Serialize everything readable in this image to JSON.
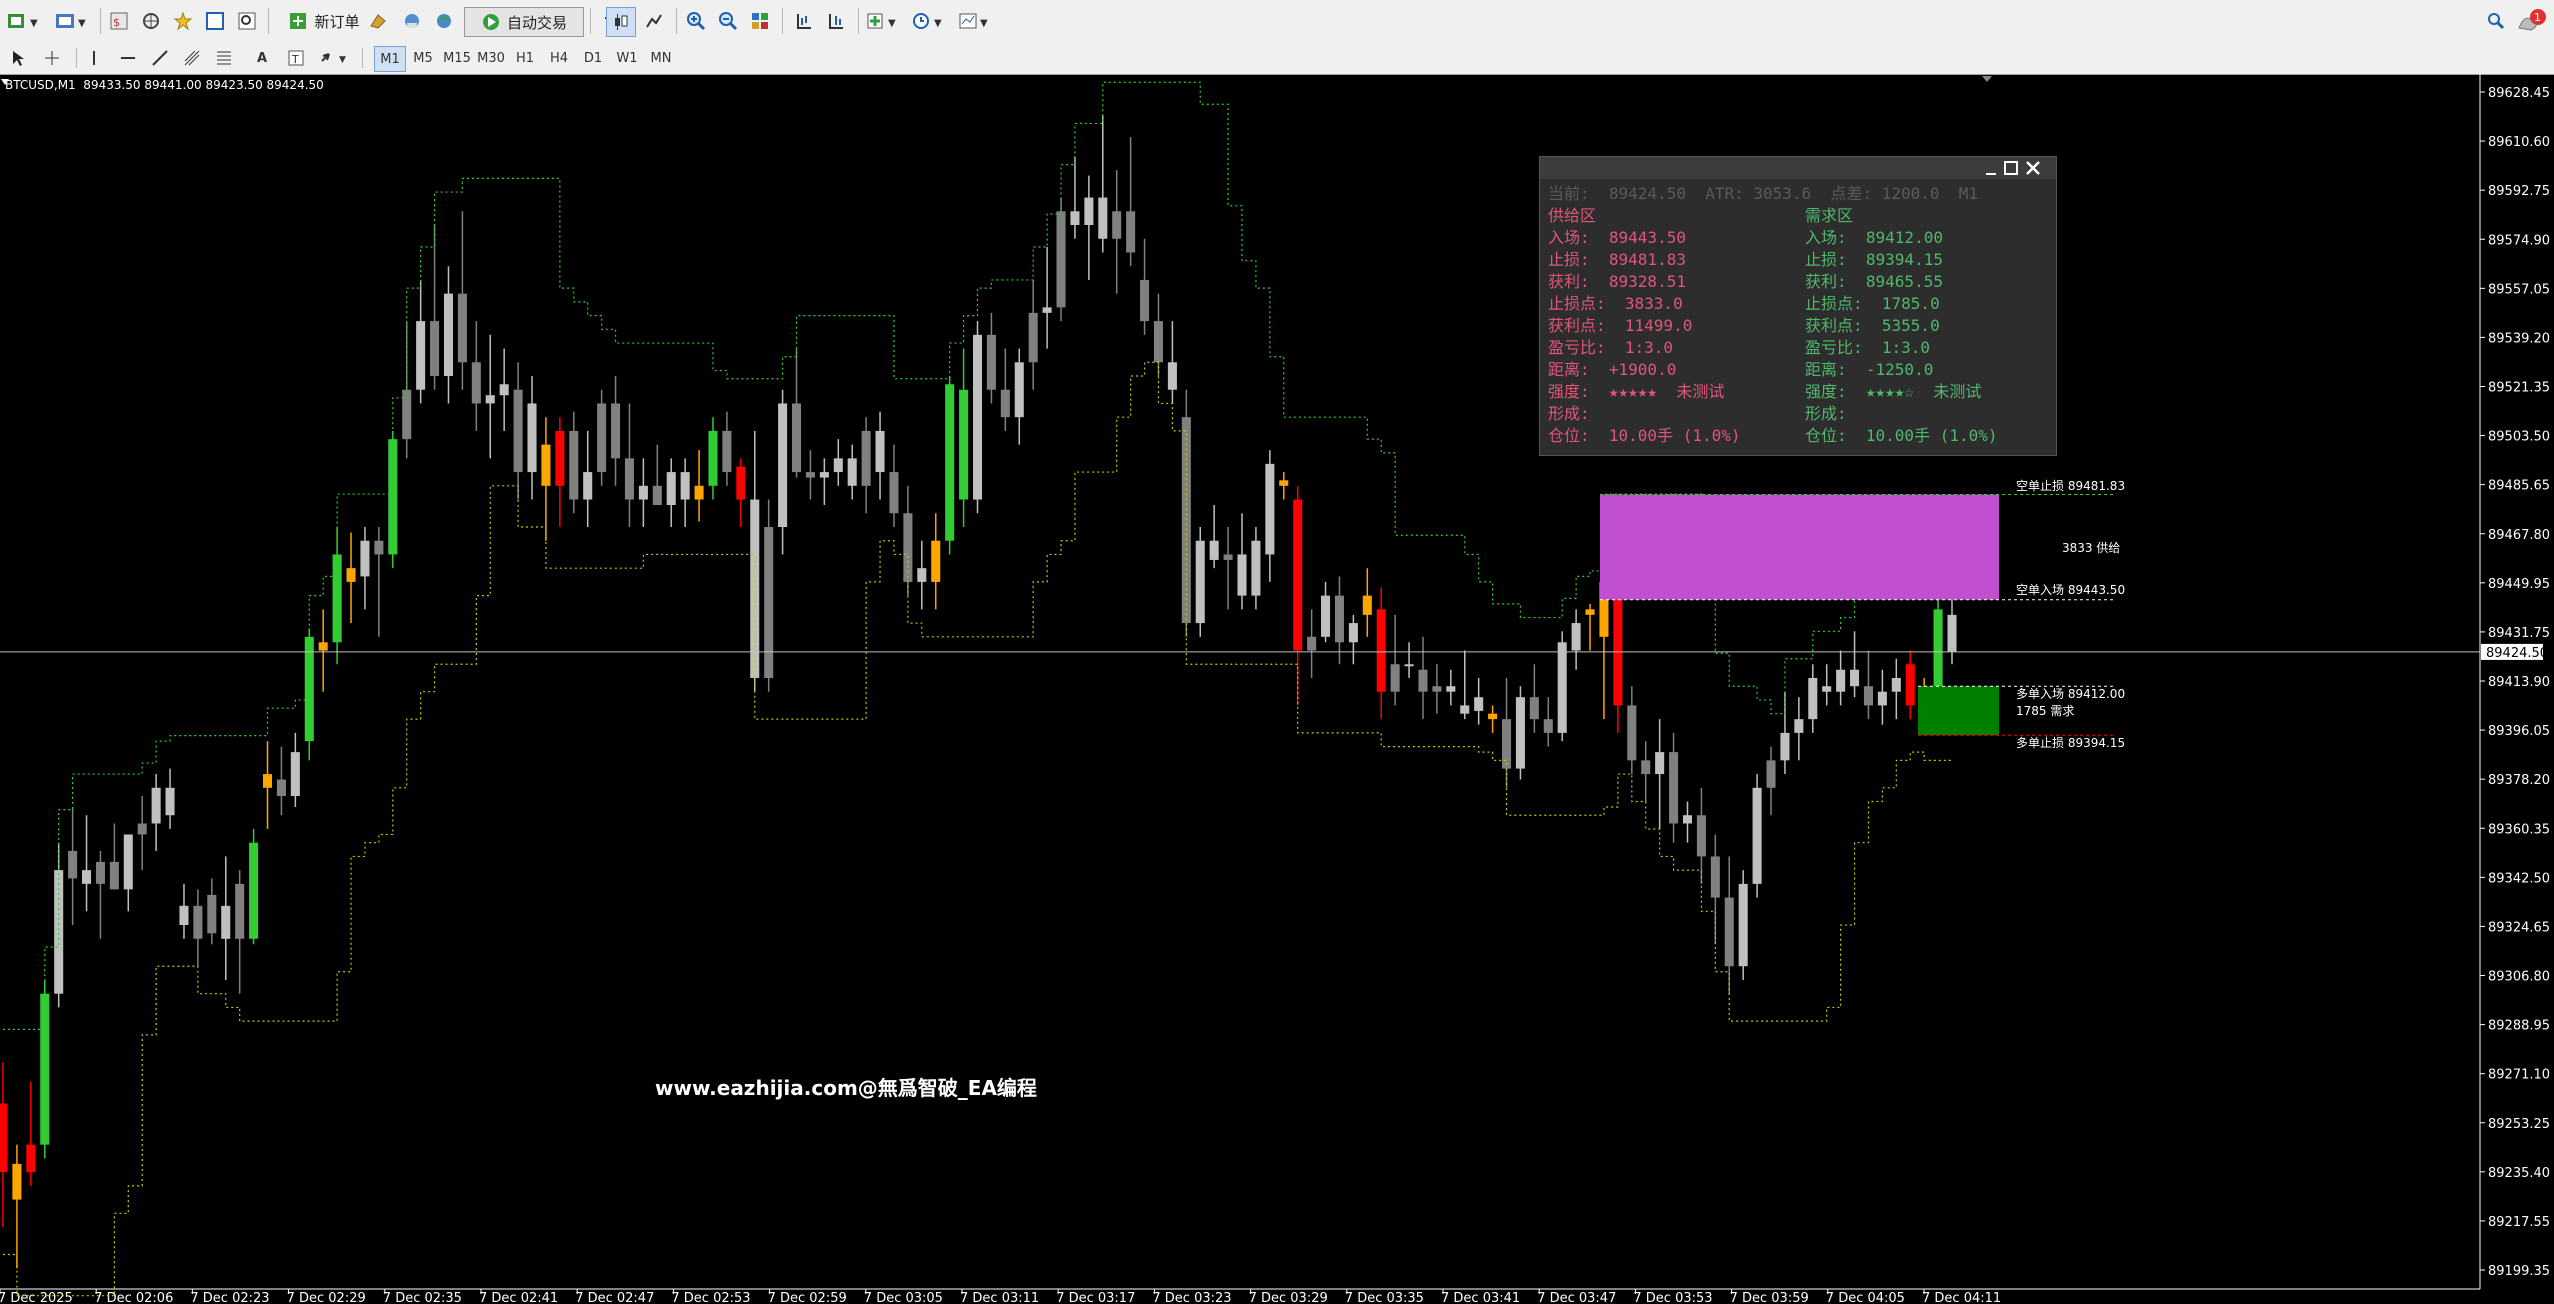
{
  "toolbar": {
    "new_order_label": "新订单",
    "auto_trade_label": "自动交易",
    "notification_count": "1"
  },
  "timeframes": [
    "M1",
    "M5",
    "M15",
    "M30",
    "H1",
    "H4",
    "D1",
    "W1",
    "MN"
  ],
  "symbol_line": "BTCUSD,M1  89433.50 89441.00 89423.50 89424.50",
  "price_axis": {
    "labels": [
      "89628.45",
      "89610.60",
      "89592.75",
      "89574.90",
      "89557.05",
      "89539.20",
      "89521.35",
      "89503.50",
      "89485.65",
      "89467.80",
      "89449.95",
      "89431.75",
      "89413.90",
      "89396.05",
      "89378.20",
      "89360.35",
      "89342.50",
      "89324.65",
      "89306.80",
      "89288.95",
      "89271.10",
      "89253.25",
      "89235.40",
      "89217.55",
      "89199.35"
    ],
    "current_price": "89424.50"
  },
  "time_axis": {
    "labels": [
      "7 Dec 2025",
      "7 Dec 02:06",
      "7 Dec 02:23",
      "7 Dec 02:29",
      "7 Dec 02:35",
      "7 Dec 02:41",
      "7 Dec 02:47",
      "7 Dec 02:53",
      "7 Dec 02:59",
      "7 Dec 03:05",
      "7 Dec 03:11",
      "7 Dec 03:17",
      "7 Dec 03:23",
      "7 Dec 03:29",
      "7 Dec 03:35",
      "7 Dec 03:41",
      "7 Dec 03:47",
      "7 Dec 03:53",
      "7 Dec 03:59",
      "7 Dec 04:05",
      "7 Dec 04:11"
    ]
  },
  "panel": {
    "header": "当前:  89424.50  ATR: 3053.6  点差: 1200.0  M1",
    "supply": {
      "title": "供给区",
      "entry": "入场:  89443.50",
      "sl": "止损:  89481.83",
      "tp": "获利:  89328.51",
      "sl_pts": "止损点:  3833.0",
      "tp_pts": "获利点:  11499.0",
      "rr": "盈亏比:  1:3.0",
      "dist": "距离:  +1900.0",
      "strength": "强度:  ★★★★★  未测试",
      "formed": "形成:",
      "position": "仓位:  10.00手 (1.0%)"
    },
    "demand": {
      "title": "需求区",
      "entry": "入场:  89412.00",
      "sl": "止损:  89394.15",
      "tp": "获利:  89465.55",
      "sl_pts": "止损点:  1785.0",
      "tp_pts": "获利点:  5355.0",
      "rr": "盈亏比:  1:3.0",
      "dist": "距离:  -1250.0",
      "strength": "强度:  ★★★★☆  未测试",
      "formed": "形成:",
      "position": "仓位:  10.00手 (1.0%)"
    }
  },
  "annotations": {
    "short_sl": "空单止损 89481.83",
    "supply_label": "3833 供给",
    "short_entry": "空单入场 89443.50",
    "long_entry": "多单入场 89412.00",
    "demand_label": "1785 需求",
    "long_sl": "多单止损 89394.15"
  },
  "watermark": "www.eazhijia.com@無爲智破_EA编程",
  "colors": {
    "supply_zone": "#c050d0",
    "demand_zone": "#008000",
    "bull": "#32cd32",
    "bear": "#ff0000",
    "neutral_bull": "#c0c0c0",
    "neutral_bear": "#808080",
    "orange": "#ffa500",
    "trail_green": "#32cd32",
    "trail_yellow": "#c8c800"
  },
  "chart_data": {
    "type": "candlestick",
    "symbol": "BTCUSD",
    "timeframe": "M1",
    "ylim": [
      89199.35,
      89628.45
    ],
    "candles": [
      [
        89260,
        89275,
        89215,
        89235,
        "r"
      ],
      [
        89225,
        89245,
        89200,
        89238,
        "o"
      ],
      [
        89245,
        89268,
        89230,
        89235,
        "r"
      ],
      [
        89245,
        89305,
        89240,
        89300,
        "g"
      ],
      [
        89300,
        89355,
        89295,
        89345,
        "w"
      ],
      [
        89342,
        89368,
        89325,
        89352,
        "d"
      ],
      [
        89345,
        89365,
        89330,
        89340,
        "w"
      ],
      [
        89340,
        89352,
        89320,
        89348,
        "d"
      ],
      [
        89348,
        89362,
        89338,
        89338,
        "d"
      ],
      [
        89338,
        89358,
        89330,
        89358,
        "w"
      ],
      [
        89358,
        89372,
        89345,
        89362,
        "d"
      ],
      [
        89362,
        89380,
        89352,
        89375,
        "w"
      ],
      [
        89375,
        89382,
        89360,
        89365,
        "w"
      ],
      [
        89325,
        89340,
        89320,
        89332,
        "w"
      ],
      [
        89332,
        89338,
        89310,
        89320,
        "d"
      ],
      [
        89322,
        89342,
        89318,
        89336,
        "d"
      ],
      [
        89332,
        89350,
        89305,
        89320,
        "w"
      ],
      [
        89340,
        89345,
        89300,
        89320,
        "d"
      ],
      [
        89320,
        89360,
        89318,
        89355,
        "g"
      ],
      [
        89375,
        89392,
        89360,
        89380,
        "o"
      ],
      [
        89378,
        89390,
        89365,
        89372,
        "d"
      ],
      [
        89372,
        89395,
        89368,
        89388,
        "w"
      ],
      [
        89392,
        89433,
        89385,
        89430,
        "g"
      ],
      [
        89425,
        89440,
        89410,
        89428,
        "o"
      ],
      [
        89428,
        89470,
        89420,
        89460,
        "g"
      ],
      [
        89450,
        89468,
        89435,
        89455,
        "o"
      ],
      [
        89452,
        89470,
        89440,
        89465,
        "w"
      ],
      [
        89465,
        89470,
        89430,
        89460,
        "d"
      ],
      [
        89460,
        89505,
        89455,
        89502,
        "g"
      ],
      [
        89502,
        89545,
        89495,
        89520,
        "d"
      ],
      [
        89520,
        89560,
        89515,
        89545,
        "w"
      ],
      [
        89545,
        89580,
        89520,
        89525,
        "d"
      ],
      [
        89525,
        89565,
        89515,
        89555,
        "w"
      ],
      [
        89555,
        89585,
        89520,
        89530,
        "d"
      ],
      [
        89530,
        89545,
        89505,
        89515,
        "d"
      ],
      [
        89515,
        89540,
        89495,
        89518,
        "w"
      ],
      [
        89518,
        89535,
        89505,
        89522,
        "w"
      ],
      [
        89520,
        89530,
        89480,
        89490,
        "d"
      ],
      [
        89490,
        89525,
        89480,
        89515,
        "w"
      ],
      [
        89500,
        89510,
        89465,
        89485,
        "o"
      ],
      [
        89485,
        89510,
        89470,
        89505,
        "r"
      ],
      [
        89505,
        89512,
        89475,
        89480,
        "d"
      ],
      [
        89480,
        89505,
        89470,
        89490,
        "w"
      ],
      [
        89490,
        89520,
        89485,
        89515,
        "d"
      ],
      [
        89515,
        89525,
        89485,
        89495,
        "d"
      ],
      [
        89495,
        89515,
        89470,
        89480,
        "d"
      ],
      [
        89480,
        89495,
        89470,
        89485,
        "w"
      ],
      [
        89485,
        89500,
        89478,
        89478,
        "d"
      ],
      [
        89478,
        89495,
        89470,
        89490,
        "w"
      ],
      [
        89490,
        89495,
        89470,
        89480,
        "w"
      ],
      [
        89480,
        89498,
        89472,
        89485,
        "o"
      ],
      [
        89485,
        89510,
        89480,
        89505,
        "g"
      ],
      [
        89505,
        89512,
        89485,
        89490,
        "d"
      ],
      [
        89492,
        89495,
        89470,
        89480,
        "r"
      ],
      [
        89480,
        89505,
        89410,
        89415,
        "w"
      ],
      [
        89415,
        89480,
        89410,
        89470,
        "d"
      ],
      [
        89470,
        89520,
        89460,
        89515,
        "w"
      ],
      [
        89515,
        89535,
        89488,
        89490,
        "d"
      ],
      [
        89490,
        89498,
        89480,
        89488,
        "d"
      ],
      [
        89488,
        89495,
        89478,
        89490,
        "w"
      ],
      [
        89490,
        89502,
        89485,
        89495,
        "w"
      ],
      [
        89495,
        89500,
        89480,
        89485,
        "w"
      ],
      [
        89485,
        89510,
        89475,
        89505,
        "d"
      ],
      [
        89505,
        89512,
        89480,
        89490,
        "w"
      ],
      [
        89490,
        89500,
        89470,
        89475,
        "d"
      ],
      [
        89475,
        89485,
        89445,
        89450,
        "d"
      ],
      [
        89450,
        89465,
        89440,
        89455,
        "w"
      ],
      [
        89450,
        89475,
        89440,
        89465,
        "o"
      ],
      [
        89465,
        89525,
        89460,
        89522,
        "g"
      ],
      [
        89520,
        89535,
        89470,
        89480,
        "g"
      ],
      [
        89480,
        89545,
        89475,
        89540,
        "w"
      ],
      [
        89540,
        89548,
        89515,
        89520,
        "d"
      ],
      [
        89520,
        89535,
        89505,
        89510,
        "d"
      ],
      [
        89510,
        89535,
        89500,
        89530,
        "w"
      ],
      [
        89530,
        89560,
        89520,
        89548,
        "d"
      ],
      [
        89548,
        89572,
        89535,
        89550,
        "w"
      ],
      [
        89550,
        89590,
        89545,
        89585,
        "d"
      ],
      [
        89585,
        89605,
        89575,
        89580,
        "w"
      ],
      [
        89580,
        89598,
        89560,
        89590,
        "w"
      ],
      [
        89590,
        89620,
        89570,
        89575,
        "w"
      ],
      [
        89575,
        89600,
        89555,
        89585,
        "d"
      ],
      [
        89585,
        89612,
        89565,
        89570,
        "d"
      ],
      [
        89560,
        89575,
        89540,
        89545,
        "d"
      ],
      [
        89545,
        89555,
        89525,
        89530,
        "d"
      ],
      [
        89530,
        89545,
        89515,
        89520,
        "w"
      ],
      [
        89510,
        89520,
        89430,
        89435,
        "d"
      ],
      [
        89435,
        89470,
        89430,
        89465,
        "w"
      ],
      [
        89465,
        89478,
        89455,
        89458,
        "w"
      ],
      [
        89458,
        89470,
        89440,
        89460,
        "d"
      ],
      [
        89460,
        89475,
        89440,
        89445,
        "w"
      ],
      [
        89445,
        89470,
        89440,
        89465,
        "w"
      ],
      [
        89460,
        89498,
        89450,
        89493,
        "w"
      ],
      [
        89485,
        89490,
        89480,
        89487,
        "o"
      ],
      [
        89480,
        89485,
        89405,
        89425,
        "r"
      ],
      [
        89425,
        89440,
        89415,
        89430,
        "d"
      ],
      [
        89430,
        89450,
        89428,
        89445,
        "w"
      ],
      [
        89445,
        89452,
        89420,
        89428,
        "d"
      ],
      [
        89428,
        89438,
        89420,
        89435,
        "w"
      ],
      [
        89445,
        89455,
        89430,
        89438,
        "o"
      ],
      [
        89440,
        89448,
        89400,
        89410,
        "r"
      ],
      [
        89410,
        89438,
        89405,
        89420,
        "d"
      ],
      [
        89420,
        89428,
        89415,
        89420,
        "w"
      ],
      [
        89418,
        89430,
        89400,
        89410,
        "d"
      ],
      [
        89410,
        89420,
        89402,
        89412,
        "d"
      ],
      [
        89412,
        89418,
        89405,
        89410,
        "w"
      ],
      [
        89405,
        89425,
        89400,
        89402,
        "w"
      ],
      [
        89408,
        89415,
        89398,
        89403,
        "w"
      ],
      [
        89400,
        89405,
        89395,
        89402,
        "o"
      ],
      [
        89400,
        89415,
        89375,
        89382,
        "d"
      ],
      [
        89382,
        89412,
        89378,
        89408,
        "w"
      ],
      [
        89408,
        89420,
        89395,
        89400,
        "d"
      ],
      [
        89400,
        89408,
        89390,
        89395,
        "d"
      ],
      [
        89395,
        89432,
        89392,
        89428,
        "w"
      ],
      [
        89425,
        89440,
        89418,
        89435,
        "w"
      ],
      [
        89440,
        89442,
        89425,
        89438,
        "o"
      ],
      [
        89430,
        89470,
        89400,
        89450,
        "o"
      ],
      [
        89450,
        89460,
        89395,
        89405,
        "r"
      ],
      [
        89405,
        89412,
        89380,
        89385,
        "d"
      ],
      [
        89385,
        89392,
        89370,
        89380,
        "d"
      ],
      [
        89380,
        89400,
        89360,
        89388,
        "w"
      ],
      [
        89388,
        89395,
        89355,
        89362,
        "d"
      ],
      [
        89362,
        89370,
        89355,
        89365,
        "w"
      ],
      [
        89365,
        89375,
        89340,
        89350,
        "d"
      ],
      [
        89350,
        89358,
        89318,
        89335,
        "d"
      ],
      [
        89335,
        89350,
        89300,
        89310,
        "d"
      ],
      [
        89310,
        89345,
        89305,
        89340,
        "w"
      ],
      [
        89340,
        89380,
        89335,
        89375,
        "w"
      ],
      [
        89375,
        89390,
        89365,
        89385,
        "d"
      ],
      [
        89385,
        89410,
        89380,
        89395,
        "w"
      ],
      [
        89395,
        89408,
        89385,
        89400,
        "w"
      ],
      [
        89400,
        89420,
        89395,
        89415,
        "w"
      ],
      [
        89412,
        89420,
        89405,
        89410,
        "w"
      ],
      [
        89410,
        89425,
        89405,
        89418,
        "w"
      ],
      [
        89418,
        89432,
        89408,
        89412,
        "w"
      ],
      [
        89412,
        89425,
        89400,
        89405,
        "d"
      ],
      [
        89405,
        89418,
        89398,
        89410,
        "w"
      ],
      [
        89410,
        89422,
        89400,
        89415,
        "w"
      ],
      [
        89420,
        89425,
        89400,
        89405,
        "r"
      ],
      [
        89400,
        89415,
        89395,
        89412,
        "o"
      ],
      [
        89412,
        89445,
        89405,
        89440,
        "g"
      ],
      [
        89438,
        89445,
        89420,
        89424.5,
        "w"
      ]
    ]
  }
}
